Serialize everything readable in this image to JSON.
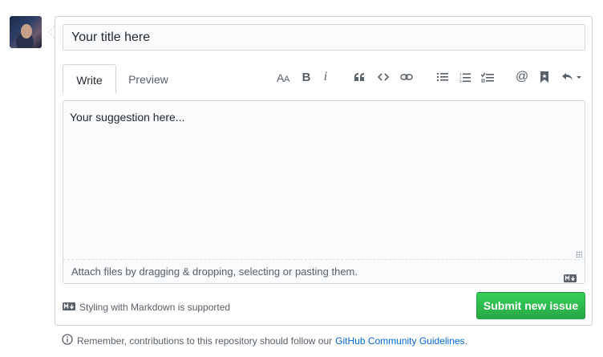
{
  "form": {
    "title_placeholder": "Your title here",
    "tabs": [
      {
        "label": "Write",
        "active": true
      },
      {
        "label": "Preview",
        "active": false
      }
    ],
    "toolbar": {
      "icons": [
        "text-size-icon",
        "bold-icon",
        "italic-icon",
        "quote-icon",
        "code-icon",
        "link-icon",
        "unordered-list-icon",
        "ordered-list-icon",
        "task-list-icon",
        "mention-icon",
        "bookmark-icon",
        "reply-icon"
      ],
      "bold_glyph": "B",
      "italic_glyph": "i",
      "mention_glyph": "@"
    },
    "body_placeholder": "Your suggestion here...",
    "attach_text": "Attach files by dragging & dropping, selecting or pasting them.",
    "markdown_hint": "Styling with Markdown is supported",
    "submit_label": "Submit new issue"
  },
  "guidelines": {
    "text": "Remember, contributions to this repository should follow our",
    "link_text": "GitHub Community Guidelines",
    "suffix": "."
  },
  "colors": {
    "primary_button": "#2ea44f",
    "link": "#0366d6",
    "border": "#d1d5da",
    "muted_text": "#586069"
  }
}
